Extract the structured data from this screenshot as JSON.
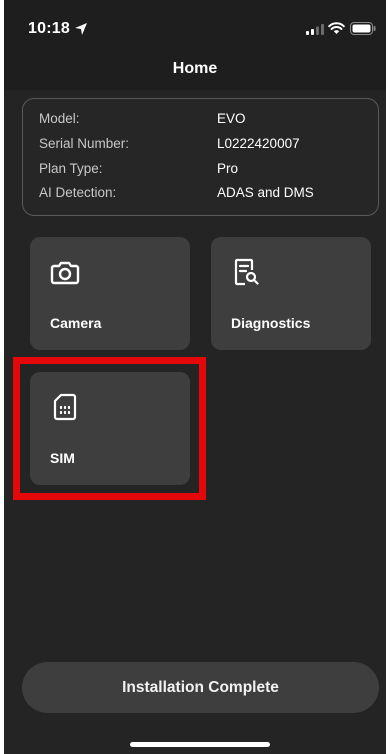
{
  "status_bar": {
    "time": "10:18",
    "icons": [
      "location-arrow-icon",
      "signal-icon",
      "wifi-icon",
      "battery-icon"
    ]
  },
  "nav": {
    "title": "Home"
  },
  "device_info": {
    "rows": [
      {
        "label": "Model:",
        "value": "EVO"
      },
      {
        "label": "Serial Number:",
        "value": "L0222420007"
      },
      {
        "label": "Plan Type:",
        "value": "Pro"
      },
      {
        "label": "AI Detection:",
        "value": "ADAS and DMS"
      }
    ]
  },
  "tiles": [
    {
      "label": "Camera",
      "icon": "camera-icon"
    },
    {
      "label": "Diagnostics",
      "icon": "document-search-icon"
    },
    {
      "label": "SIM",
      "icon": "sim-card-icon"
    }
  ],
  "footer": {
    "install_label": "Installation Complete"
  },
  "colors": {
    "background": "#242424",
    "tile": "#3e3e3e",
    "highlight": "#e4080a",
    "text": "#ffffff"
  }
}
